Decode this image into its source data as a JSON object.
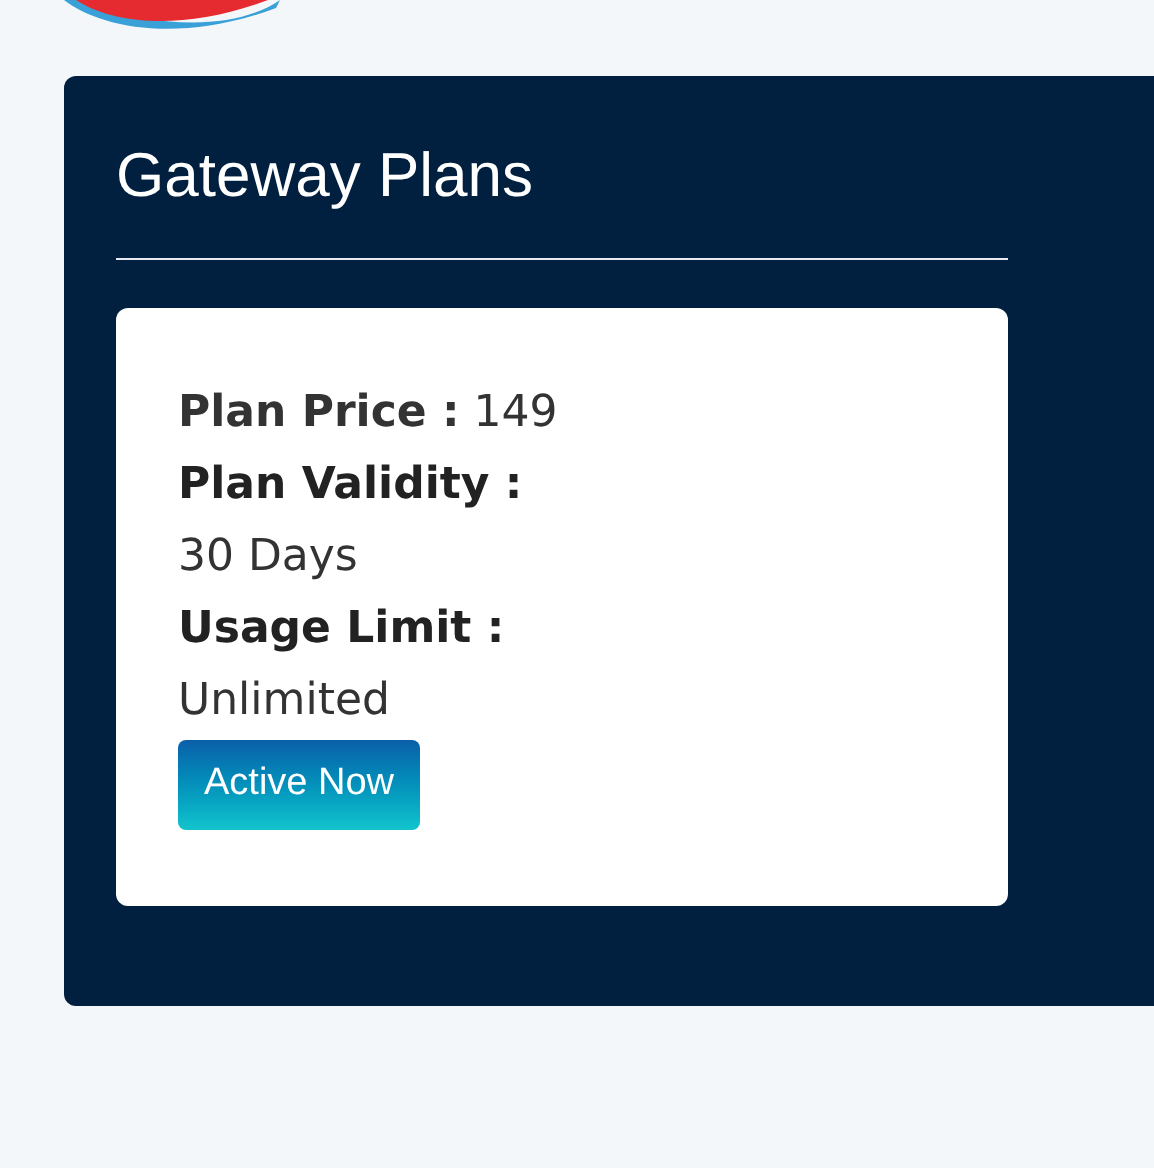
{
  "panel": {
    "title": "Gateway Plans"
  },
  "plan": {
    "lines": [
      {
        "kind": "pair",
        "text": "**Plan Price :** 149"
      },
      {
        "kind": "label",
        "text": "Plan Validity :"
      },
      {
        "kind": "value",
        "text": "30 Days"
      },
      {
        "kind": "label",
        "text": "Usage Limit :"
      },
      {
        "kind": "value",
        "text": "Unlimited"
      }
    ],
    "button": "Active Now"
  }
}
